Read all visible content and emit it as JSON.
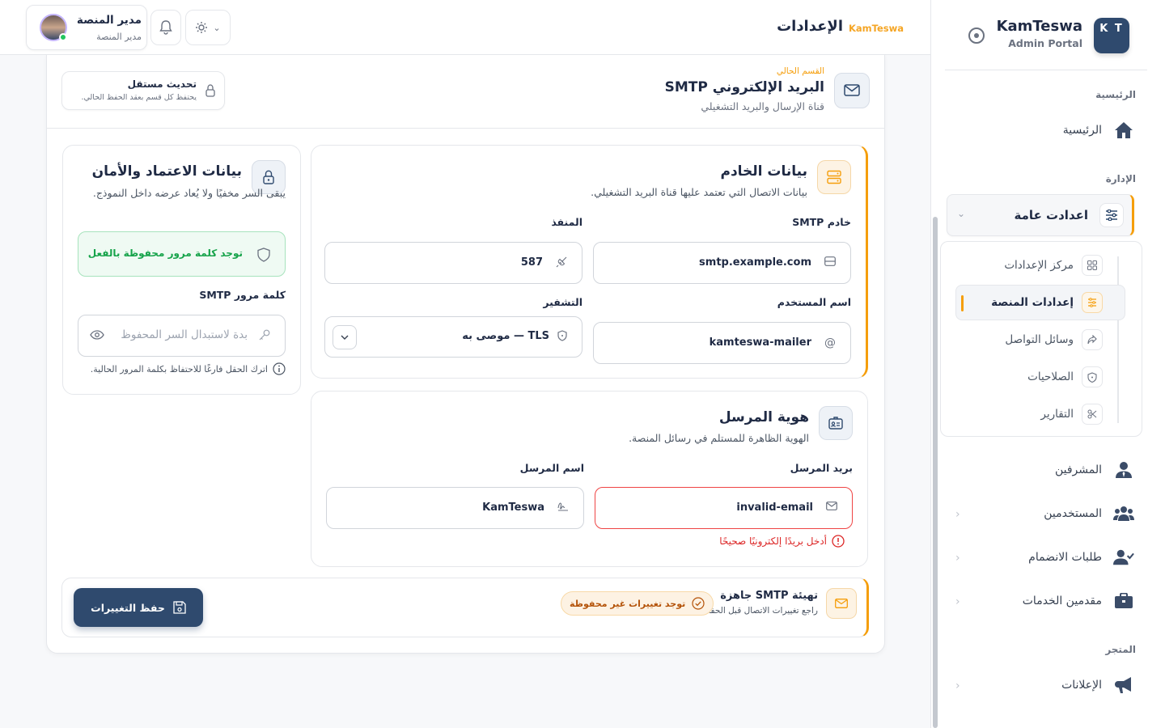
{
  "sidebar": {
    "brand_logo": "K T",
    "brand_name": "KamTeswa",
    "brand_sub": "Admin Portal",
    "sections": {
      "home": "الرئيسية",
      "admin": "الإدارة",
      "store": "المتجر"
    },
    "home_item": "الرئيسية",
    "active_group": "اعدادت عامة",
    "sub_items": [
      {
        "label": "مركز الإعدادات",
        "icon": "grid-icon"
      },
      {
        "label": "إعدادات المنصة",
        "icon": "sliders-icon",
        "active": true
      },
      {
        "label": "وسائل التواصل",
        "icon": "share-icon"
      },
      {
        "label": "الصلاحيات",
        "icon": "shield-icon"
      },
      {
        "label": "التقارير",
        "icon": "scissors-icon"
      }
    ],
    "items": [
      {
        "label": "المشرفين",
        "icon": "user-tie-icon"
      },
      {
        "label": "المستخدمين",
        "icon": "users-icon"
      },
      {
        "label": "طلبات الانضمام",
        "icon": "user-check-icon"
      },
      {
        "label": "مقدمين الخدمات",
        "icon": "briefcase-icon"
      }
    ],
    "store_items": [
      {
        "label": "الإعلانات",
        "icon": "megaphone-icon"
      }
    ]
  },
  "header": {
    "title": "الإعدادات",
    "brand": "KamTeswa",
    "user_name": "مدير المنصة",
    "user_role": "مدير المنصة"
  },
  "section": {
    "tag": "القسم الحالي",
    "title": "البريد الإلكتروني SMTP",
    "subtitle": "قناة الإرسال والبريد التشغيلي",
    "indep_title": "تحديث مستقل",
    "indep_sub": "يحتفظ كل قسم بعقد الحفظ الحالي."
  },
  "server": {
    "title": "بيانات الخادم",
    "subtitle": "بيانات الاتصال التي تعتمد عليها قناة البريد التشغيلي.",
    "smtp_label": "خادم SMTP",
    "smtp_value": "smtp.example.com",
    "port_label": "المنفذ",
    "port_value": "587",
    "user_label": "اسم المستخدم",
    "user_value": "kamteswa-mailer",
    "enc_label": "التشفير",
    "enc_value": "TLS — موصى به"
  },
  "credentials": {
    "title": "بيانات الاعتماد والأمان",
    "subtitle": "يبقى السر مخفيًا ولا يُعاد عرضه داخل النموذج.",
    "saved_notice": "توجد كلمة مرور محفوظة بالفعل",
    "pw_label": "كلمة مرور SMTP",
    "pw_placeholder": "بدة لاستبدال السر المحفوظ",
    "hint": "اترك الحقل فارغًا للاحتفاظ بكلمة المرور الحالية."
  },
  "sender": {
    "title": "هوية المرسل",
    "subtitle": "الهوية الظاهرة للمستلم في رسائل المنصة.",
    "email_label": "بريد المرسل",
    "email_value": "invalid-email",
    "email_error": "أدخل بريدًا إلكترونيًا صحيحًا",
    "name_label": "اسم المرسل",
    "name_value": "KamTeswa"
  },
  "footer": {
    "title": "تهيئة SMTP جاهزة",
    "subtitle": "راجع تغييرات الاتصال قبل الحفظ.",
    "unsaved": "توجد تغييرات غير محفوظة",
    "save": "حفظ التغييرات"
  },
  "colors": {
    "accent": "#f59e0b",
    "primary": "#2f4a6e",
    "error": "#dc2626",
    "success": "#16a34a"
  }
}
